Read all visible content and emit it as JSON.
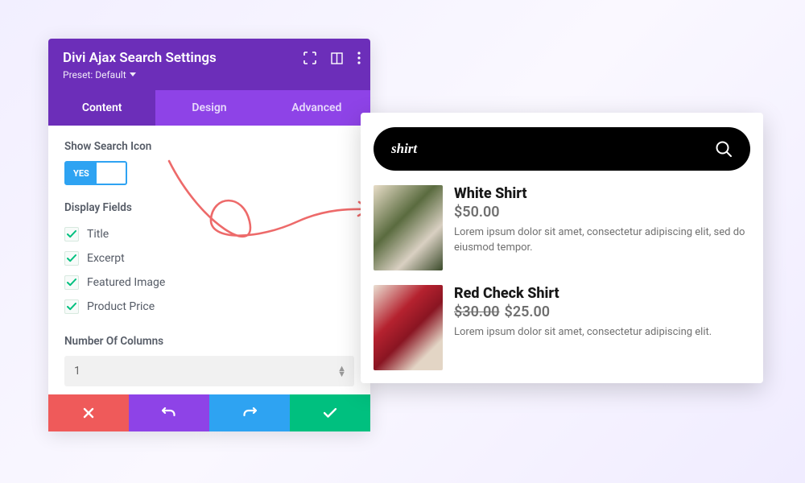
{
  "panel": {
    "title": "Divi Ajax Search Settings",
    "preset_label": "Preset: Default",
    "tabs": [
      "Content",
      "Design",
      "Advanced"
    ],
    "active_tab": 0,
    "show_search_icon_label": "Show Search Icon",
    "toggle_yes": "YES",
    "display_fields_label": "Display Fields",
    "fields": [
      "Title",
      "Excerpt",
      "Featured Image",
      "Product Price"
    ],
    "columns_label": "Number Of Columns",
    "columns_value": "1"
  },
  "search": {
    "query": "shirt",
    "results": [
      {
        "title": "White Shirt",
        "price": "$50.00",
        "old_price": "",
        "desc": "Lorem ipsum dolor sit amet, consectetur adipiscing elit, sed do eiusmod tempor."
      },
      {
        "title": "Red Check Shirt",
        "price": "$25.00",
        "old_price": "$30.00",
        "desc": "Lorem ipsum dolor sit amet, consectetur adipiscing elit."
      }
    ]
  }
}
